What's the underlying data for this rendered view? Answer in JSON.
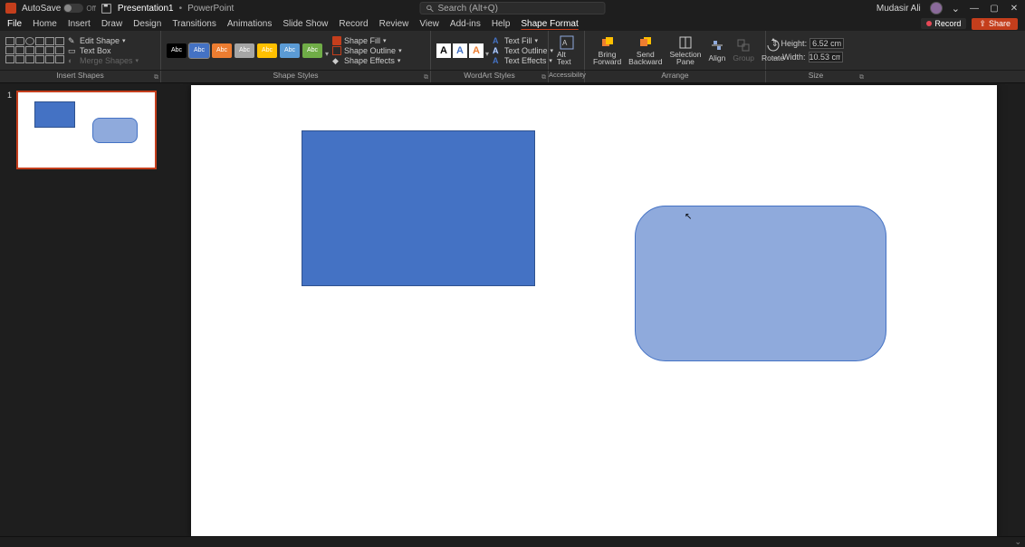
{
  "title": {
    "autosave": "AutoSave",
    "autosave_state": "Off",
    "doc": "Presentation1",
    "app": "PowerPoint",
    "search_placeholder": "Search (Alt+Q)",
    "user": "Mudasir Ali"
  },
  "tabs": {
    "file": "File",
    "list": [
      "Home",
      "Insert",
      "Draw",
      "Design",
      "Transitions",
      "Animations",
      "Slide Show",
      "Record",
      "Review",
      "View",
      "Add-ins",
      "Help"
    ],
    "context": "Shape Format",
    "record": "Record",
    "share": "Share"
  },
  "ribbon": {
    "insert_shapes": {
      "edit_shape": "Edit Shape",
      "text_box": "Text Box",
      "merge_shapes": "Merge Shapes",
      "label": "Insert Shapes"
    },
    "shape_styles": {
      "swatch_text": "Abc",
      "colors": [
        "#000000",
        "#4472c4",
        "#ed7d31",
        "#a5a5a5",
        "#ffc000",
        "#5b9bd5",
        "#70ad47"
      ],
      "shape_fill": "Shape Fill",
      "shape_outline": "Shape Outline",
      "shape_effects": "Shape Effects",
      "label": "Shape Styles"
    },
    "wordart": {
      "letter": "A",
      "text_fill": "Text Fill",
      "text_outline": "Text Outline",
      "text_effects": "Text Effects",
      "label": "WordArt Styles"
    },
    "accessibility": {
      "alt_text": "Alt Text",
      "label": "Accessibility"
    },
    "arrange": {
      "bring_forward": "Bring Forward",
      "send_backward": "Send Backward",
      "selection_pane": "Selection Pane",
      "align": "Align",
      "group": "Group",
      "rotate": "Rotate",
      "label": "Arrange"
    },
    "size": {
      "height_label": "Height:",
      "height_value": "6.52 cm",
      "width_label": "Width:",
      "width_value": "10.53 cm",
      "label": "Size"
    }
  },
  "slide": {
    "number": "1"
  },
  "status": {}
}
